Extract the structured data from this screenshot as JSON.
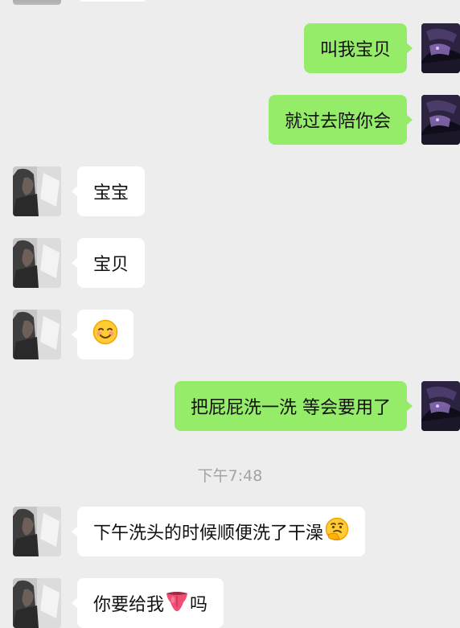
{
  "messages": [
    {
      "side": "right",
      "text": "叫我宝贝"
    },
    {
      "side": "right",
      "text": "就过去陪你会"
    },
    {
      "side": "left",
      "text": "宝宝"
    },
    {
      "side": "left",
      "text": "宝贝"
    },
    {
      "side": "left",
      "emoji": "smiling-face-icon"
    },
    {
      "side": "right",
      "text": "把屁屁洗一洗 等会要用了"
    },
    {
      "side": "left",
      "text": "下午洗头的时候顺便洗了干澡",
      "emoji": "thinking-face-icon"
    },
    {
      "side": "left",
      "text_before": "你要给我",
      "emoji": "tongue-icon",
      "text_after": "吗"
    }
  ],
  "time_divider": "下午7:48",
  "colors": {
    "background": "#ededed",
    "sent_bubble": "#95ec69",
    "received_bubble": "#ffffff",
    "timestamp": "#a3a3a3"
  }
}
